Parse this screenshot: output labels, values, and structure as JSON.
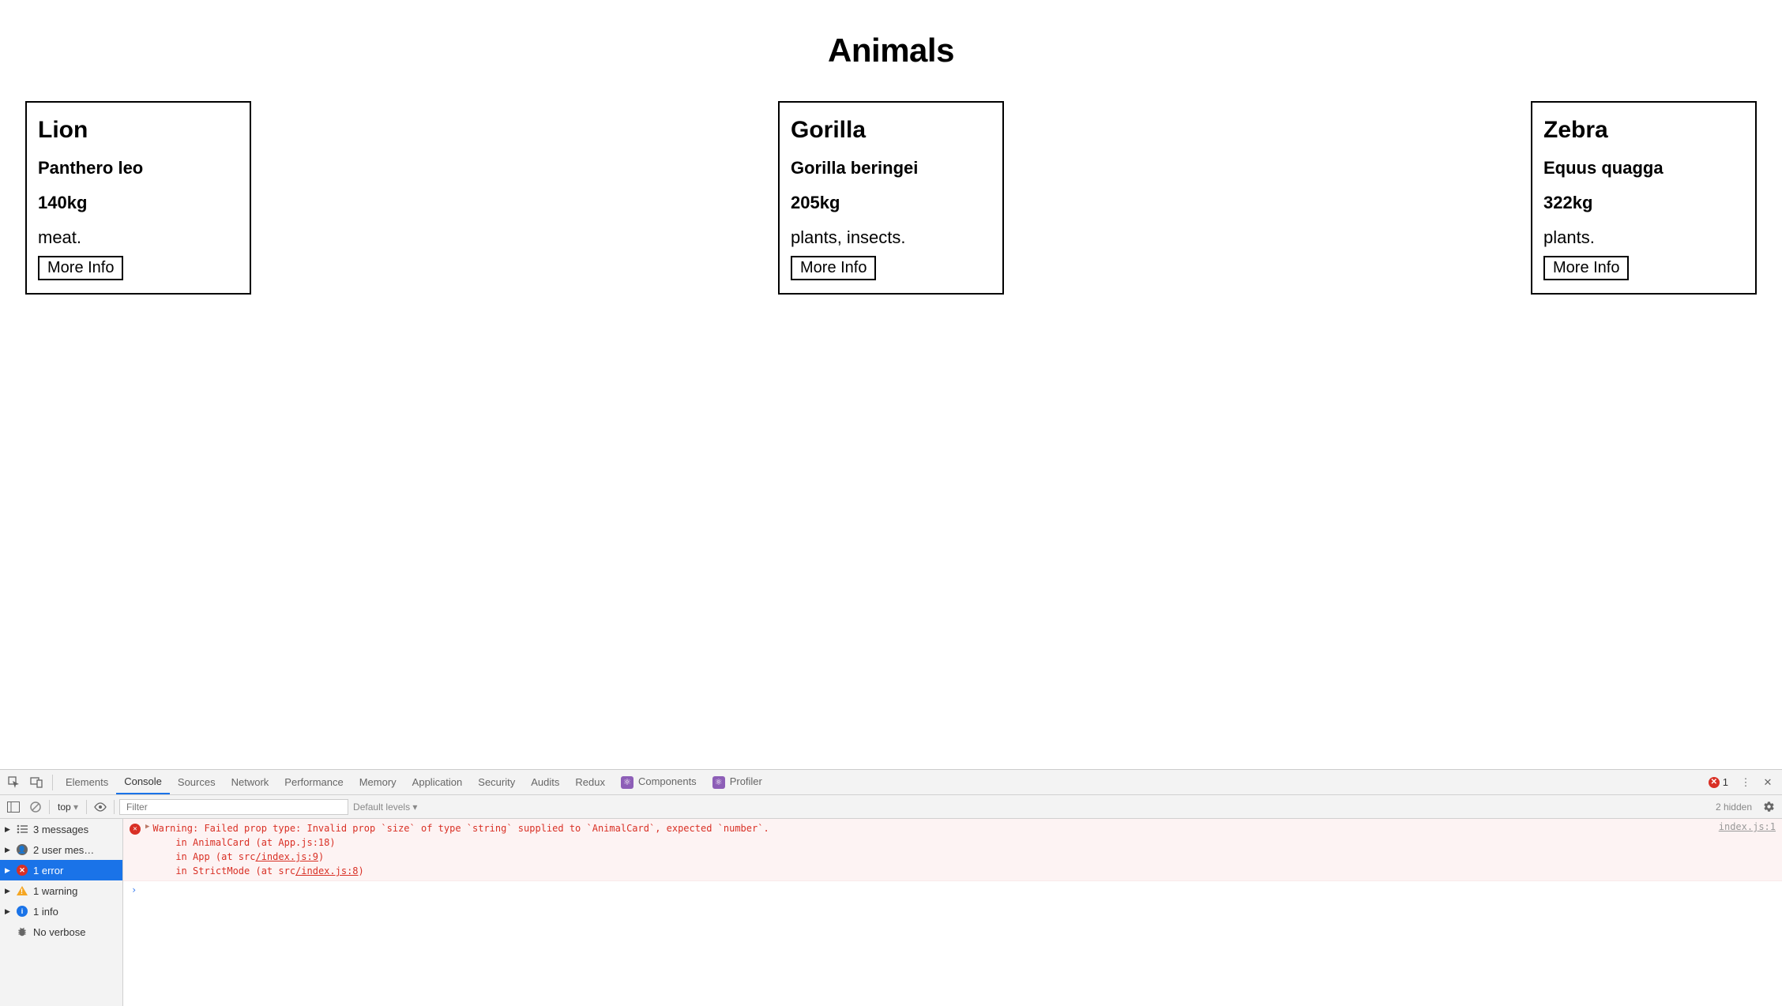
{
  "page": {
    "title": "Animals"
  },
  "cards": [
    {
      "name": "Lion",
      "latin": "Panthero leo",
      "weight": "140kg",
      "diet": "meat.",
      "button": "More Info"
    },
    {
      "name": "Gorilla",
      "latin": "Gorilla beringei",
      "weight": "205kg",
      "diet": "plants, insects.",
      "button": "More Info"
    },
    {
      "name": "Zebra",
      "latin": "Equus quagga",
      "weight": "322kg",
      "diet": "plants.",
      "button": "More Info"
    }
  ],
  "devtools": {
    "tabs": [
      "Elements",
      "Console",
      "Sources",
      "Network",
      "Performance",
      "Memory",
      "Application",
      "Security",
      "Audits",
      "Redux",
      "Components",
      "Profiler"
    ],
    "active_tab": "Console",
    "error_count": "1",
    "toolbar": {
      "context": "top",
      "filter_placeholder": "Filter",
      "levels": "Default levels ▾",
      "hidden": "2 hidden"
    },
    "sidebar": [
      {
        "icon": "list",
        "label": "3 messages"
      },
      {
        "icon": "user",
        "label": "2 user mes…"
      },
      {
        "icon": "error",
        "label": "1 error",
        "selected": true
      },
      {
        "icon": "warn",
        "label": "1 warning"
      },
      {
        "icon": "info",
        "label": "1 info"
      },
      {
        "icon": "bug",
        "label": "No verbose"
      }
    ],
    "console": {
      "message_line1": "Warning: Failed prop type: Invalid prop `size` of type `string` supplied to `AnimalCard`, expected `number`.",
      "message_line2": "    in AnimalCard (at App.js:18)",
      "message_line3_pre": "    in App (at src",
      "message_line3_link": "/index.js:9",
      "message_line3_post": ")",
      "message_line4_pre": "    in StrictMode (at src",
      "message_line4_link": "/index.js:8",
      "message_line4_post": ")",
      "source": "index.js:1",
      "prompt": "›"
    }
  }
}
